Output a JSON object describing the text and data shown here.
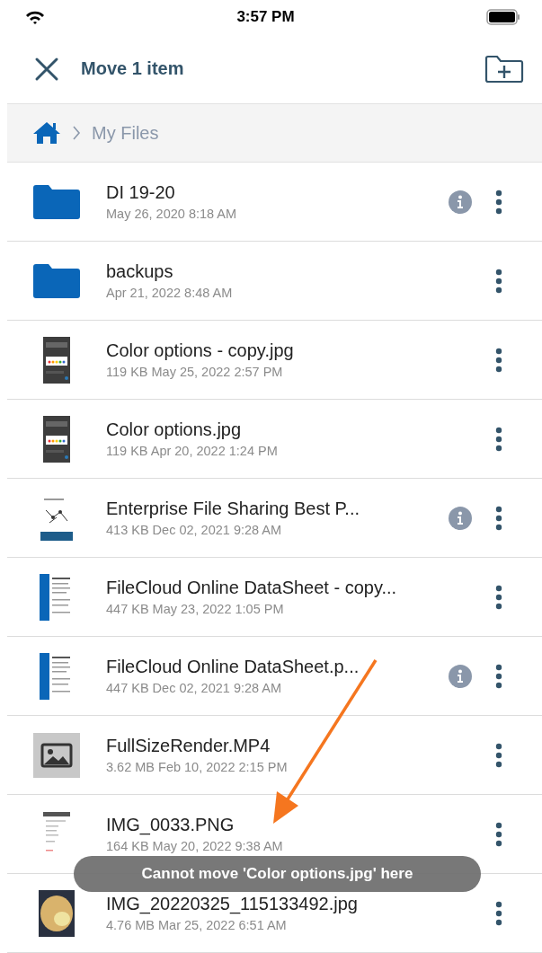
{
  "status_bar": {
    "time": "3:57 PM"
  },
  "toolbar": {
    "title": "Move 1 item"
  },
  "breadcrumb": {
    "path": [
      "My Files"
    ]
  },
  "files": [
    {
      "name": "DI 19-20",
      "meta": "May 26, 2020 8:18 AM",
      "kind": "folder",
      "info": true
    },
    {
      "name": "backups",
      "meta": "Apr 21, 2022 8:48 AM",
      "kind": "folder",
      "info": false
    },
    {
      "name": "Color options - copy.jpg",
      "meta": "119 KB May 25, 2022 2:57 PM",
      "kind": "screenshot",
      "info": false
    },
    {
      "name": "Color options.jpg",
      "meta": "119 KB Apr 20, 2022 1:24 PM",
      "kind": "screenshot",
      "info": false
    },
    {
      "name": "Enterprise File Sharing Best P...",
      "meta": "413 KB Dec 02, 2021 9:28 AM",
      "kind": "diagram",
      "info": true
    },
    {
      "name": "FileCloud Online DataSheet - copy...",
      "meta": "447 KB May 23, 2022 1:05 PM",
      "kind": "document",
      "info": false
    },
    {
      "name": "FileCloud Online DataSheet.p...",
      "meta": "447 KB Dec 02, 2021 9:28 AM",
      "kind": "document",
      "info": true
    },
    {
      "name": "FullSizeRender.MP4",
      "meta": "3.62 MB Feb 10, 2022 2:15 PM",
      "kind": "media",
      "info": false
    },
    {
      "name": "IMG_0033.PNG",
      "meta": "164 KB May 20, 2022 9:38 AM",
      "kind": "page",
      "info": false
    },
    {
      "name": "IMG_20220325_115133492.jpg",
      "meta": "4.76 MB Mar 25, 2022 6:51 AM",
      "kind": "photo",
      "info": false
    }
  ],
  "toast": {
    "message": "Cannot move 'Color options.jpg' here"
  }
}
